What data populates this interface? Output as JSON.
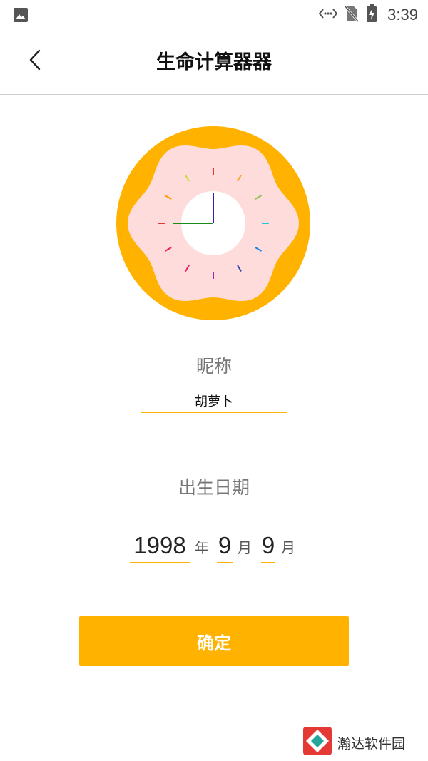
{
  "status_bar": {
    "notification_icon": "image-icon",
    "icons": [
      "data-transfer-icon",
      "no-sim-icon",
      "battery-charging-icon"
    ],
    "time": "3:39"
  },
  "header": {
    "back_icon": "chevron-left-icon",
    "title": "生命计算器器"
  },
  "clock": {
    "outer_color": "#ffb300",
    "donut_color": "#ffdcdc",
    "center_color": "#ffffff",
    "hour_hand_color": "#1b8a1b",
    "minute_hand_color": "#3b1fa8",
    "tick_colors": [
      "#e53935",
      "#f9a825",
      "#8bc34a",
      "#26c6da",
      "#1e88e5",
      "#3949ab",
      "#9c27b0",
      "#e91e63",
      "#e91e63",
      "#e53935",
      "#ff9800",
      "#cddc39"
    ]
  },
  "form": {
    "nickname_label": "昵称",
    "nickname_value": "胡萝卜",
    "birth_label": "出生日期",
    "year_value": "1998",
    "year_unit": "年",
    "month_value": "9",
    "month_unit": "月",
    "day_value": "9",
    "day_unit": "月",
    "accent_color": "#ffb300"
  },
  "confirm_button": {
    "label": "确定"
  },
  "watermark": {
    "text": "瀚达软件园"
  }
}
